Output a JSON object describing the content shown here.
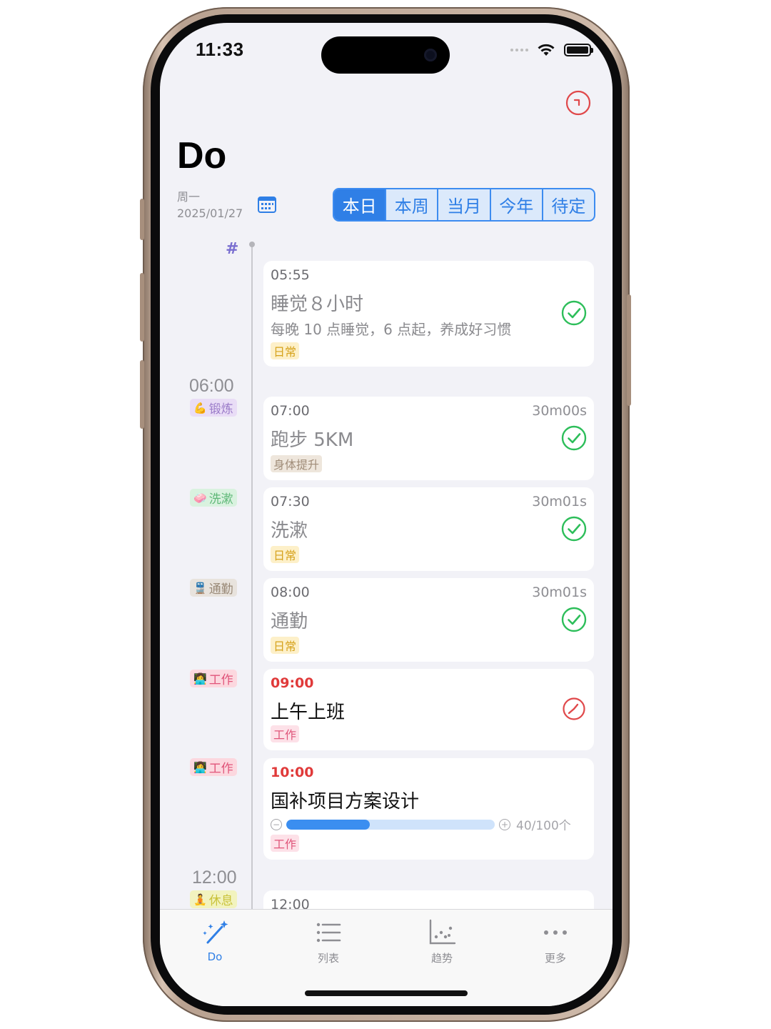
{
  "status_bar": {
    "time": "11:33"
  },
  "header": {
    "title": "Do",
    "weekday": "周一",
    "date": "2025/01/27",
    "segments": [
      "本日",
      "本周",
      "当月",
      "今年",
      "待定"
    ],
    "active_segment": "本日"
  },
  "timeline": {
    "hash_symbol": "#",
    "hours": [
      "06:00",
      "12:00"
    ],
    "side_tags": [
      {
        "emoji": "💪",
        "label": "锻炼",
        "bg": "#e9ddf6",
        "color": "#9b7cc9"
      },
      {
        "emoji": "🧼",
        "label": "洗漱",
        "bg": "#d9f2df",
        "color": "#5fb878"
      },
      {
        "emoji": "🚆",
        "label": "通勤",
        "bg": "#e8e3dd",
        "color": "#9a8a78"
      },
      {
        "emoji": "👩‍💻",
        "label": "工作",
        "bg": "#fcd8df",
        "color": "#e0557a"
      },
      {
        "emoji": "👩‍💻",
        "label": "工作",
        "bg": "#fcd8df",
        "color": "#e0557a"
      },
      {
        "emoji": "🧘",
        "label": "休息",
        "bg": "#f2f3bf",
        "color": "#c9c23a"
      }
    ]
  },
  "tasks": [
    {
      "time": "05:55",
      "title": "睡觉８小时",
      "desc": "每晚 10 点睡觉，6 点起，养成好习惯",
      "tag": "日常",
      "status": "done"
    },
    {
      "time": "07:00",
      "duration": "30m00s",
      "title": "跑步 5KM",
      "tag": "身体提升",
      "status": "done"
    },
    {
      "time": "07:30",
      "duration": "30m01s",
      "title": "洗漱",
      "tag": "日常",
      "status": "done"
    },
    {
      "time": "08:00",
      "duration": "30m01s",
      "title": "通勤",
      "tag": "日常",
      "status": "done"
    },
    {
      "time": "09:00",
      "title": "上午上班",
      "tag": "工作",
      "status": "in-progress"
    },
    {
      "time": "10:00",
      "title": "国补项目方案设计",
      "tag": "工作",
      "progress_text": "40/100个",
      "progress": 0.4
    },
    {
      "time": "12:00"
    }
  ],
  "tab_bar": {
    "items": [
      {
        "label": "Do",
        "icon": "magic-wand-icon",
        "active": true
      },
      {
        "label": "列表",
        "icon": "list-icon",
        "active": false
      },
      {
        "label": "趋势",
        "icon": "scatter-chart-icon",
        "active": false
      },
      {
        "label": "更多",
        "icon": "more-dots-icon",
        "active": false
      }
    ]
  },
  "colors": {
    "accent": "#2f7fe6",
    "done_green": "#2dbe5a",
    "active_red": "#e03a3a"
  }
}
